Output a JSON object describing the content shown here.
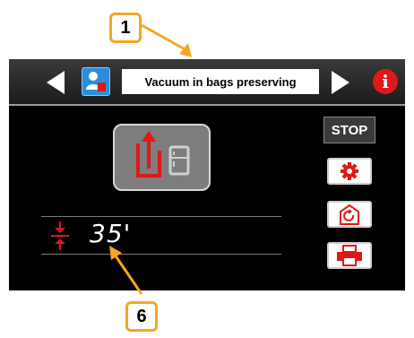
{
  "header": {
    "title": "Vacuum in bags preserving",
    "prev_icon": "left-arrow-icon",
    "next_icon": "right-arrow-icon",
    "program_icon": "program-user-icon",
    "info_label": "i"
  },
  "main": {
    "cycle_button_icon": "vacuum-preserve-icon"
  },
  "sidebar": {
    "stop_label": "STOP",
    "buttons": [
      {
        "icon": "gear-icon"
      },
      {
        "icon": "cycle-restart-icon"
      },
      {
        "icon": "printer-icon"
      }
    ]
  },
  "timer": {
    "icon": "vacuum-compress-icon",
    "value": "35'"
  },
  "callouts": [
    {
      "label": "1"
    },
    {
      "label": "6"
    }
  ],
  "colors": {
    "accent_red": "#e01818",
    "callout_orange": "#f5a623",
    "program_blue": "#2a8fd8"
  }
}
